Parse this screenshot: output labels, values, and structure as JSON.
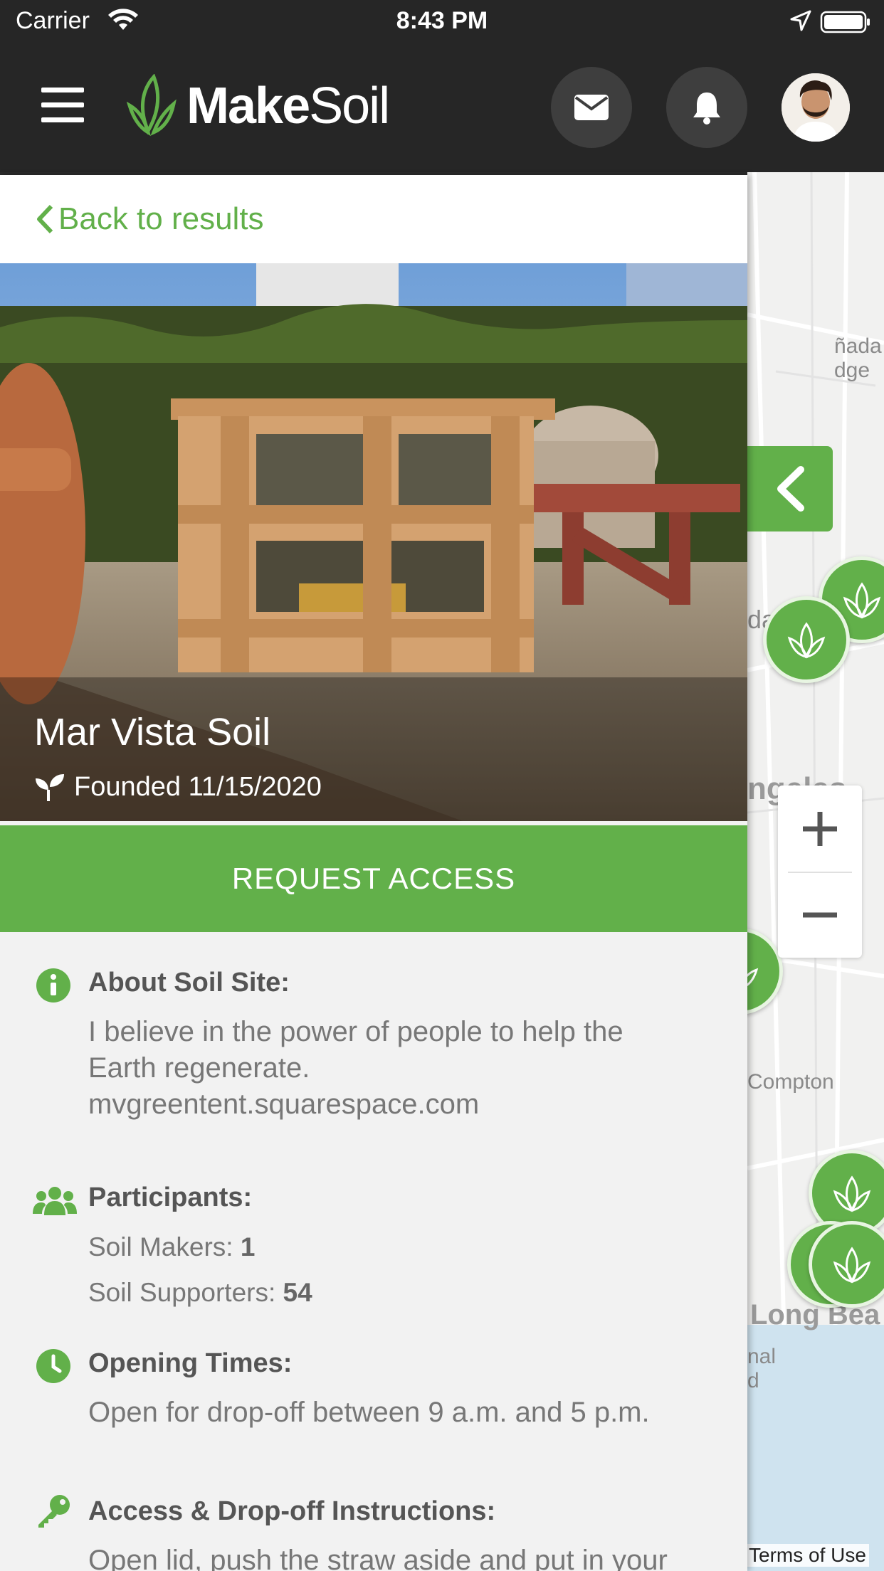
{
  "status_bar": {
    "carrier": "Carrier",
    "time": "8:43 PM"
  },
  "header": {
    "logo_bold": "Make",
    "logo_light": "Soil",
    "icons": [
      "menu-icon",
      "mail-icon",
      "bell-icon",
      "avatar"
    ]
  },
  "panel": {
    "back_label": "Back to results",
    "site_title": "Mar Vista Soil",
    "founded": "Founded 11/15/2020",
    "request_access": "REQUEST ACCESS",
    "about": {
      "title": "About Soil Site:",
      "line1": "I believe in the power of people to help the",
      "line2": "Earth regenerate.",
      "line3": "mvgreentent.squarespace.com"
    },
    "participants": {
      "title": "Participants:",
      "makers_label": "Soil Makers:",
      "makers_count": "1",
      "supporters_label": "Soil Supporters:",
      "supporters_count": "54"
    },
    "opening_times": {
      "title": "Opening Times:",
      "text": "Open for drop-off between 9 a.m. and 5 p.m."
    },
    "access": {
      "title": "Access & Drop-off Instructions:",
      "text": "Open lid, push the straw aside and put in your"
    }
  },
  "map": {
    "labels": {
      "canada": "ñada",
      "bridge": "dge",
      "da": "da",
      "angeles": "ngeles",
      "compton": "Compton",
      "long_beach": "Long Bea",
      "nal": "nal",
      "d": "d"
    },
    "terms": "Terms of Use"
  },
  "colors": {
    "brand_green": "#62b04a",
    "header_bg": "#262626",
    "panel_bg": "#f2f2f2"
  }
}
